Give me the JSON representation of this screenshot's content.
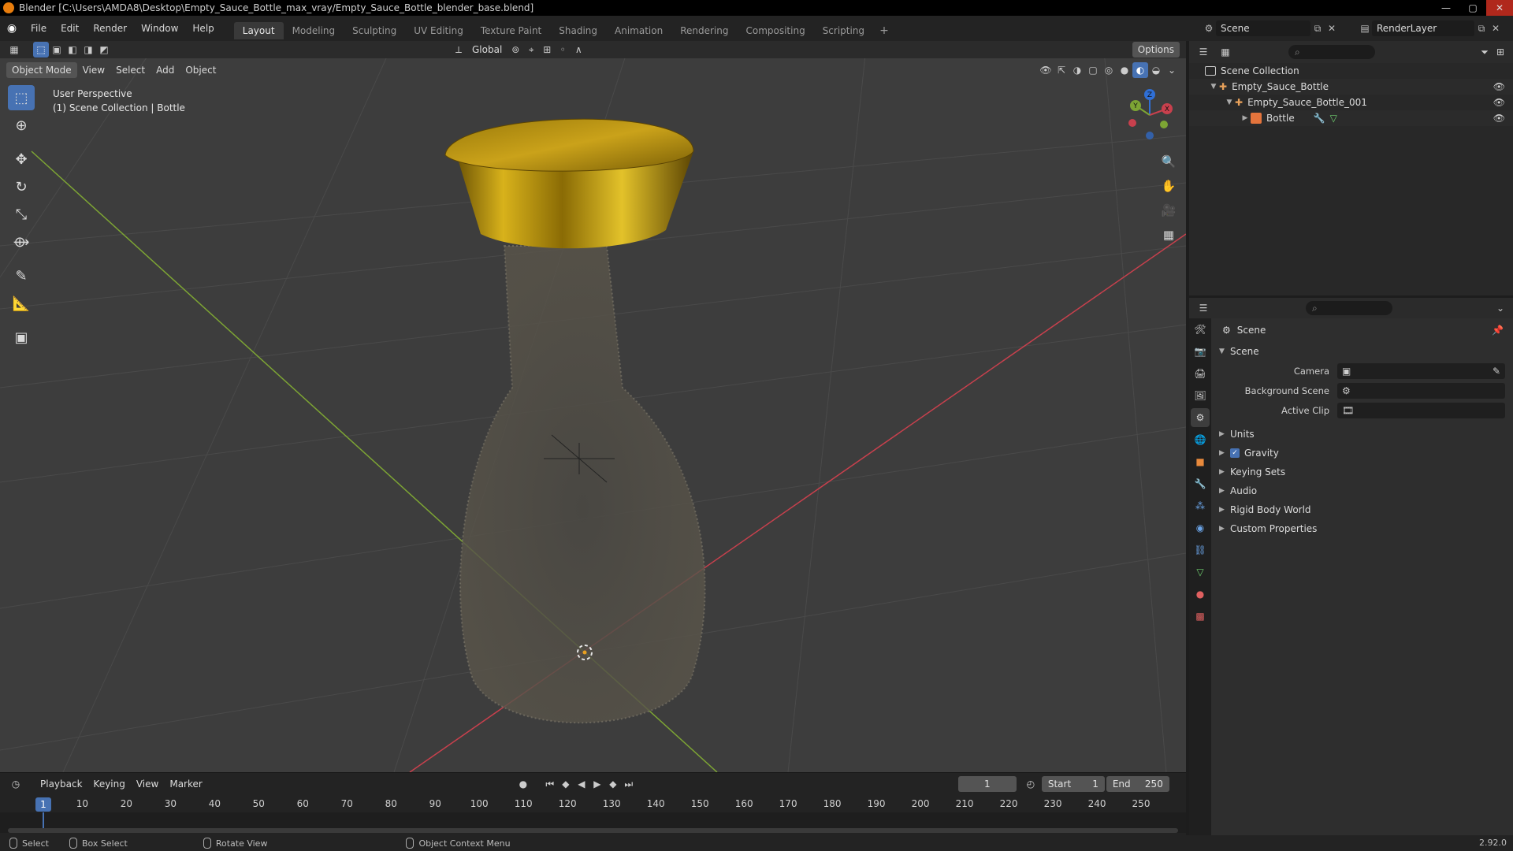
{
  "window": {
    "title": "Blender [C:\\Users\\AMDA8\\Desktop\\Empty_Sauce_Bottle_max_vray/Empty_Sauce_Bottle_blender_base.blend]",
    "min": "—",
    "max": "▢",
    "close": "✕"
  },
  "menu": [
    "File",
    "Edit",
    "Render",
    "Window",
    "Help"
  ],
  "workspaces": [
    "Layout",
    "Modeling",
    "Sculpting",
    "UV Editing",
    "Texture Paint",
    "Shading",
    "Animation",
    "Rendering",
    "Compositing",
    "Scripting"
  ],
  "workspace_add": "+",
  "scene_selector": "Scene",
  "layer_selector": "RenderLayer",
  "viewport": {
    "transform_orientation": "Global",
    "options": "Options",
    "mode": "Object Mode",
    "menus": [
      "View",
      "Select",
      "Add",
      "Object"
    ],
    "perspective": "User Perspective",
    "collection_info": "(1) Scene Collection | Bottle",
    "gizmo_axes": {
      "x": "X",
      "y": "Y",
      "z": "Z"
    }
  },
  "outliner": {
    "root": "Scene Collection",
    "items": [
      {
        "label": "Empty_Sauce_Bottle"
      },
      {
        "label": "Empty_Sauce_Bottle_001"
      },
      {
        "label": "Bottle"
      }
    ]
  },
  "properties": {
    "context": "Scene",
    "panel": "Scene",
    "fields": [
      {
        "label": "Camera",
        "value": ""
      },
      {
        "label": "Background Scene",
        "value": ""
      },
      {
        "label": "Active Clip",
        "value": ""
      }
    ],
    "subpanels": [
      "Units",
      "Gravity",
      "Keying Sets",
      "Audio",
      "Rigid Body World",
      "Custom Properties"
    ],
    "gravity_checked": true
  },
  "timeline": {
    "menus": [
      "Playback",
      "Keying",
      "View",
      "Marker"
    ],
    "current_frame": "1",
    "start_label": "Start",
    "start": "1",
    "end_label": "End",
    "end": "250",
    "ticks": [
      "1",
      "10",
      "20",
      "30",
      "40",
      "50",
      "60",
      "70",
      "80",
      "90",
      "100",
      "110",
      "120",
      "130",
      "140",
      "150",
      "160",
      "170",
      "180",
      "190",
      "200",
      "210",
      "220",
      "230",
      "240",
      "250"
    ]
  },
  "statusbar": {
    "select": "Select",
    "box_select": "Box Select",
    "rotate_view": "Rotate View",
    "context_menu": "Object Context Menu",
    "version": "2.92.0"
  },
  "colors": {
    "accent": "#4772b3",
    "viewport_bg": "#3d3d3d",
    "x_axis": "#c8404d",
    "y_axis": "#7da534",
    "cap_gold": "#c9a00c"
  }
}
